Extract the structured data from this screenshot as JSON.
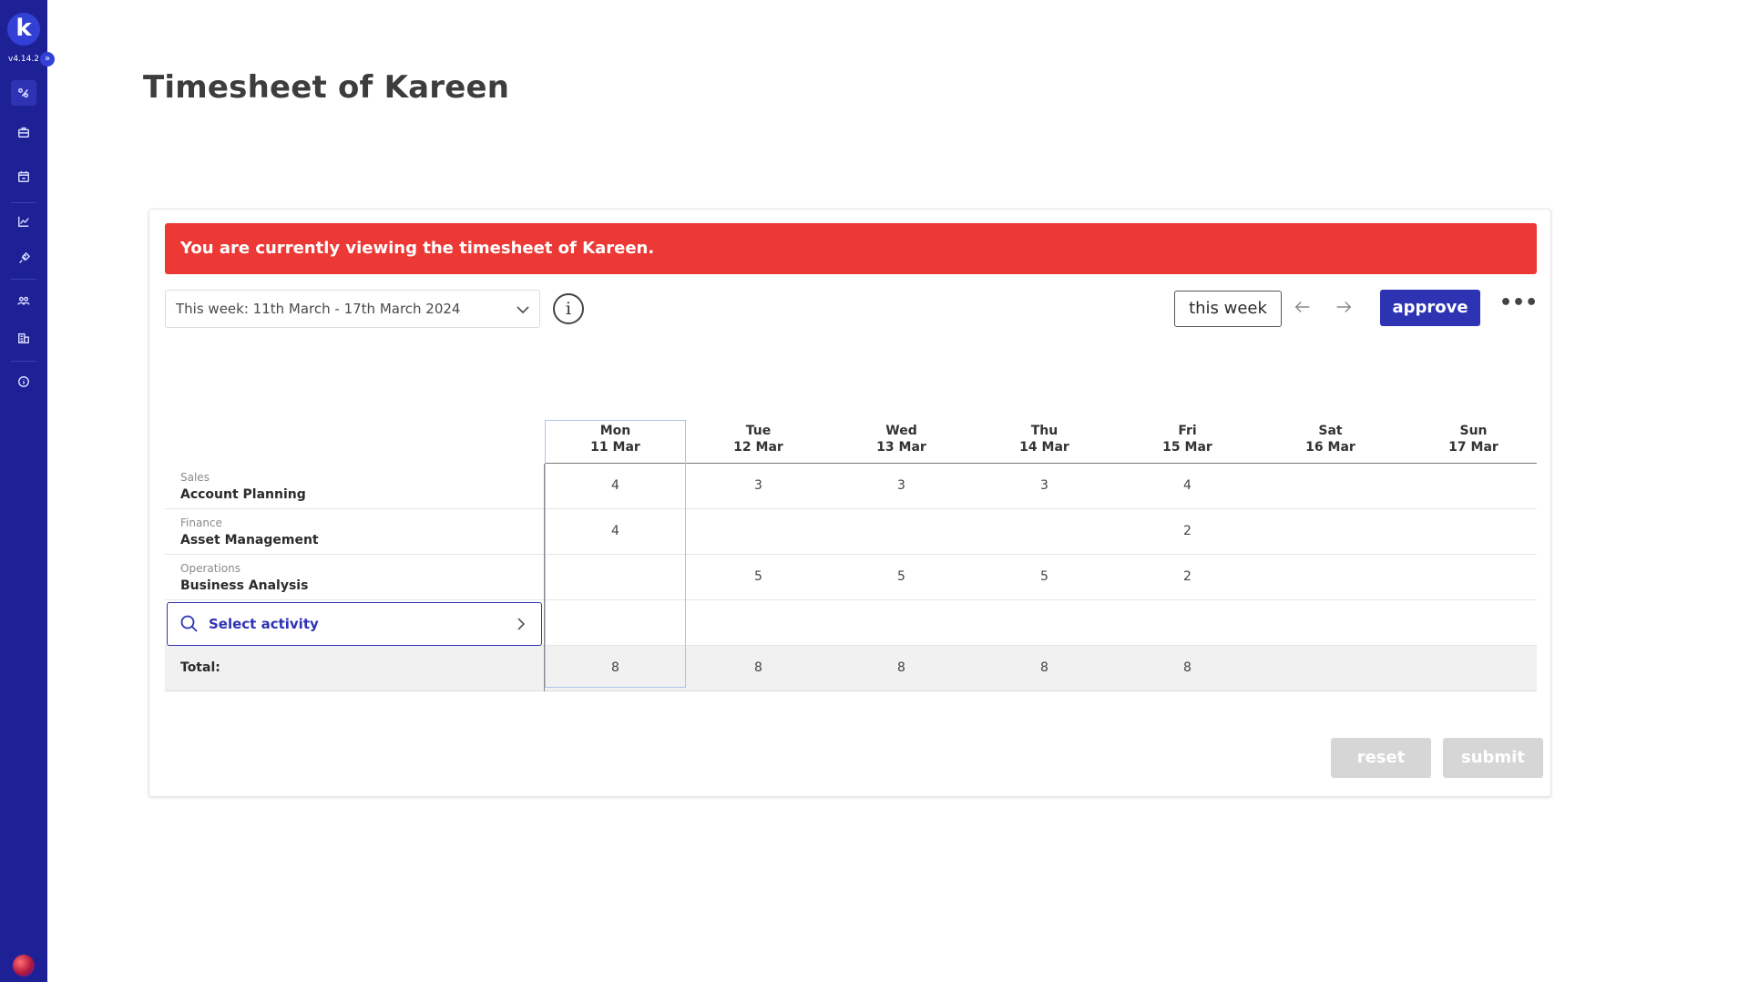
{
  "app": {
    "logo_letter": "k",
    "version": "v4.14.2",
    "colors": {
      "sidebar": "#1e2196",
      "accent": "#2e33b4",
      "alert": "#ed3936",
      "disabled": "#d6d6d6"
    }
  },
  "sidebar": {
    "items": [
      {
        "icon": "activities-icon",
        "active": true
      },
      {
        "icon": "briefcase-icon",
        "active": false
      },
      {
        "icon": "calendar-icon",
        "active": false
      },
      {
        "icon": "chart-icon",
        "active": false
      },
      {
        "icon": "plugin-icon",
        "active": false
      },
      {
        "icon": "team-icon",
        "active": false
      },
      {
        "icon": "building-icon",
        "active": false
      },
      {
        "icon": "info-icon",
        "active": false
      }
    ]
  },
  "page": {
    "title": "Timesheet of Kareen"
  },
  "alert": {
    "text": "You are currently viewing the timesheet of Kareen."
  },
  "toolbar": {
    "week_select_value": "This week: 11th March - 17th March 2024",
    "info_label": "i",
    "this_week_label": "this week",
    "approve_label": "approve",
    "more_label": "•••"
  },
  "table": {
    "days": [
      {
        "day": "Mon",
        "date": "11 Mar"
      },
      {
        "day": "Tue",
        "date": "12 Mar"
      },
      {
        "day": "Wed",
        "date": "13 Mar"
      },
      {
        "day": "Thu",
        "date": "14 Mar"
      },
      {
        "day": "Fri",
        "date": "15 Mar"
      },
      {
        "day": "Sat",
        "date": "16 Mar"
      },
      {
        "day": "Sun",
        "date": "17 Mar"
      }
    ],
    "rows": [
      {
        "category": "Sales",
        "activity": "Account Planning",
        "hours": [
          "4",
          "3",
          "3",
          "3",
          "4",
          "",
          ""
        ]
      },
      {
        "category": "Finance",
        "activity": "Asset Management",
        "hours": [
          "4",
          "",
          "",
          "",
          "2",
          "",
          ""
        ]
      },
      {
        "category": "Operations",
        "activity": "Business Analysis",
        "hours": [
          "",
          "5",
          "5",
          "5",
          "2",
          "",
          ""
        ]
      }
    ],
    "select_activity_label": "Select activity",
    "total_label": "Total:",
    "totals": [
      "8",
      "8",
      "8",
      "8",
      "8",
      "",
      ""
    ]
  },
  "footer": {
    "reset_label": "reset",
    "submit_label": "submit"
  }
}
